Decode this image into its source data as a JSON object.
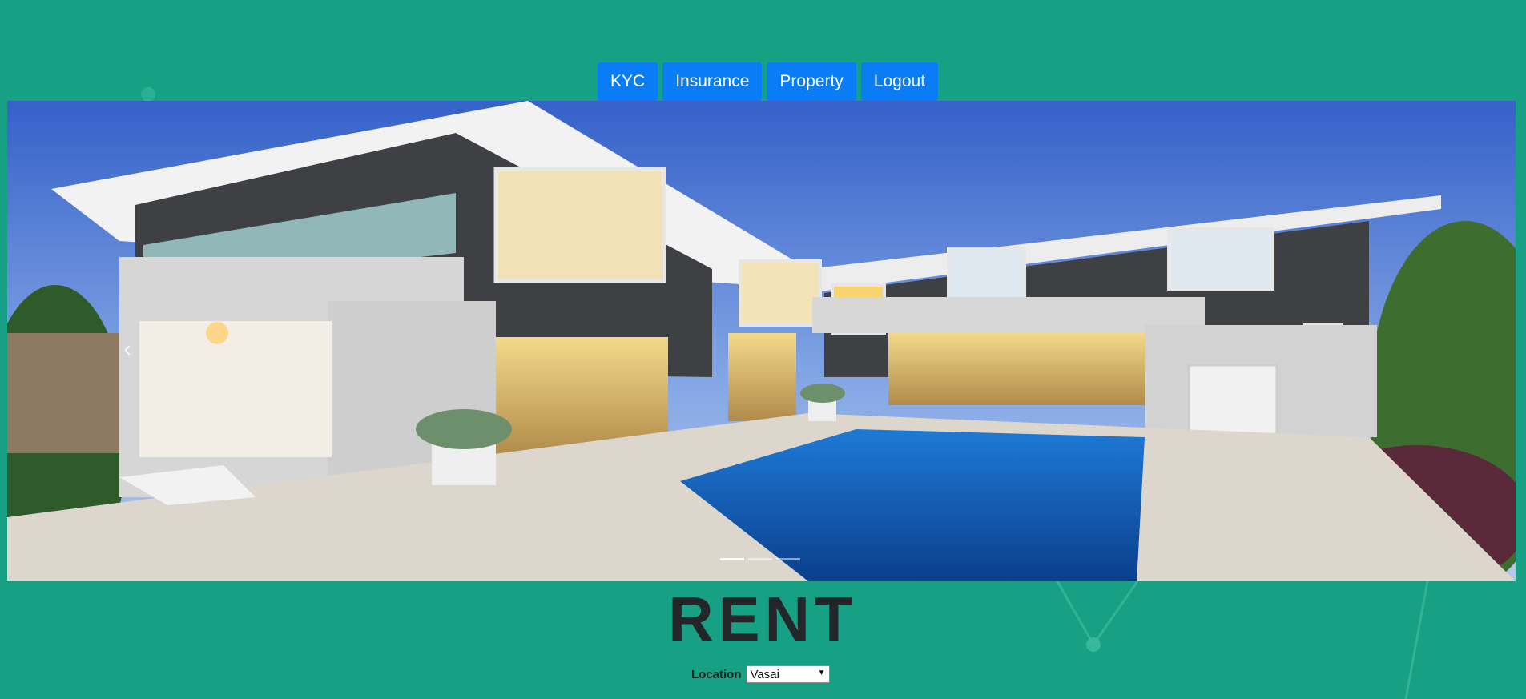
{
  "nav": {
    "items": [
      {
        "label": "KYC"
      },
      {
        "label": "Insurance"
      },
      {
        "label": "Property"
      },
      {
        "label": "Logout"
      }
    ],
    "button_color": "#0a7cf5"
  },
  "carousel": {
    "prev_icon": "chevron-left-icon",
    "slide_count": 3,
    "active_slide": 0,
    "image_description_icon": "house-photo"
  },
  "page": {
    "title": "RENT",
    "background_color": "#18a084"
  },
  "location": {
    "label": "Location",
    "selected": "Vasai"
  }
}
